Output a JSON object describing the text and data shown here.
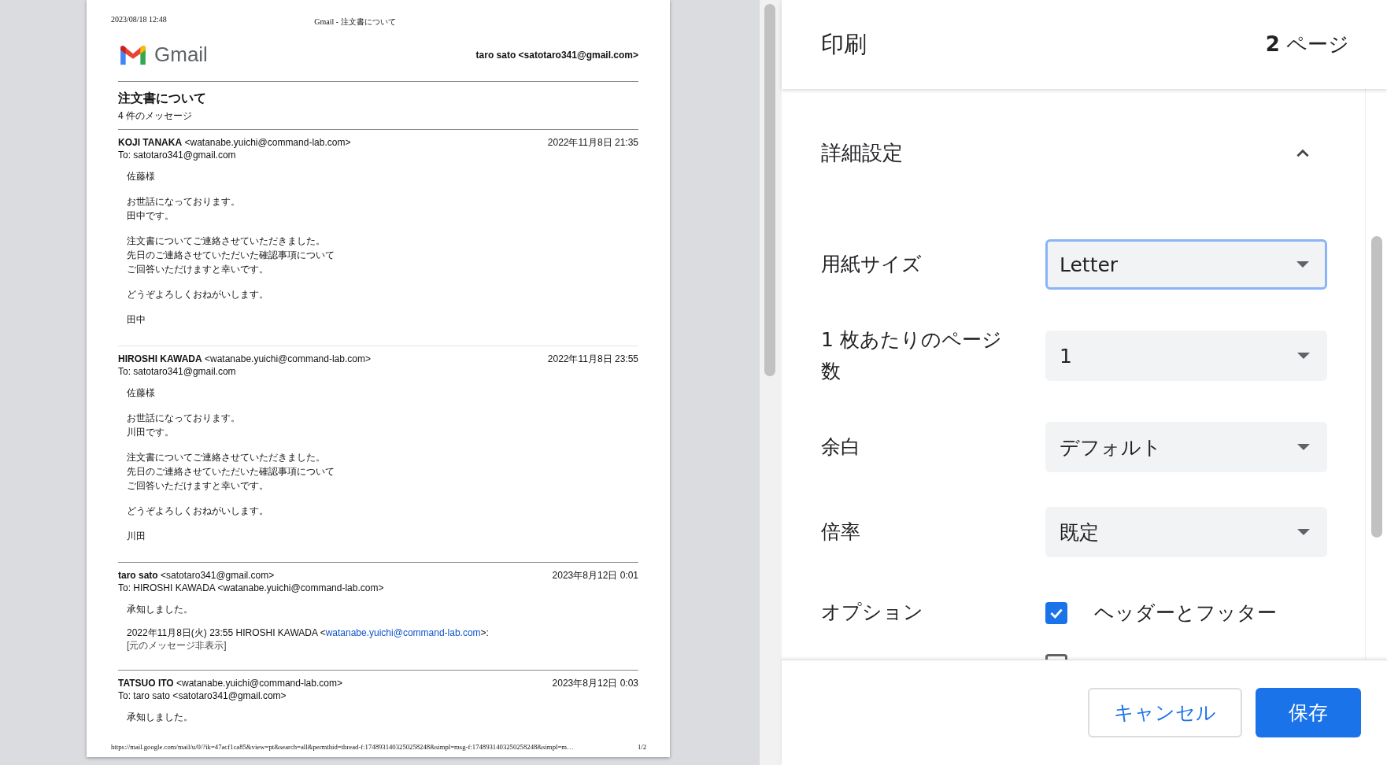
{
  "preview": {
    "header_date": "2023/08/18 12:48",
    "header_title": "Gmail - 注文書について",
    "brand": "Gmail",
    "account": "taro sato <satotaro341@gmail.com>",
    "subject": "注文書について",
    "message_count": "4 件のメッセージ",
    "messages": [
      {
        "sender_name": "KOJI TANAKA",
        "sender_email": "<watanabe.yuichi@command-lab.com>",
        "date": "2022年11月8日 21:35",
        "to": "To: satotaro341@gmail.com",
        "body": [
          [
            "佐藤様"
          ],
          [
            "お世話になっております。",
            "田中です。"
          ],
          [
            "注文書についてご連絡させていただきました。",
            "先日のご連絡させていただいた確認事項について",
            "ご回答いただけますと幸いです。"
          ],
          [
            "どうぞよろしくおねがいします。"
          ],
          [
            "田中"
          ]
        ]
      },
      {
        "sender_name": "HIROSHI KAWADA",
        "sender_email": "<watanabe.yuichi@command-lab.com>",
        "date": "2022年11月8日 23:55",
        "to": "To: satotaro341@gmail.com",
        "body": [
          [
            "佐藤様"
          ],
          [
            "お世話になっております。",
            "川田です。"
          ],
          [
            "注文書についてご連絡させていただきました。",
            "先日のご連絡させていただいた確認事項について",
            "ご回答いただけますと幸いです。"
          ],
          [
            "どうぞよろしくおねがいします。"
          ],
          [
            "川田"
          ]
        ]
      },
      {
        "sender_name": "taro sato",
        "sender_email": "<satotaro341@gmail.com>",
        "date": "2023年8月12日 0:01",
        "to": "To: HIROSHI KAWADA <watanabe.yuichi@command-lab.com>",
        "body": [
          [
            "承知しました。"
          ]
        ],
        "quote": {
          "before": "2022年11月8日(火) 23:55 HIROSHI KAWADA <",
          "link": "watanabe.yuichi@command-lab.com",
          "after": ">:"
        },
        "hidden_note": "[元のメッセージ非表示]"
      },
      {
        "sender_name": "TATSUO ITO",
        "sender_email": "<watanabe.yuichi@command-lab.com>",
        "date": "2023年8月12日 0:03",
        "to": "To: taro sato <satotaro341@gmail.com>",
        "body": [
          [
            "承知しました。"
          ]
        ]
      }
    ],
    "footer_url": "https://mail.google.com/mail/u/0/?ik=47acf1ca85&view=pt&search=all&permthid=thread-f:1748931403250258248&simpl=msg-f:1748931403250258248&simpl=m…",
    "footer_page": "1/2"
  },
  "print_panel": {
    "title": "印刷",
    "page_count": "**2** ページ",
    "advanced": {
      "label": "詳細設定",
      "expanded": true
    },
    "settings": [
      {
        "label": "用紙サイズ",
        "value": "Letter",
        "focused": true
      },
      {
        "label": "1 枚あたりのページ数",
        "value": "1",
        "focused": false
      },
      {
        "label": "余白",
        "value": "デフォルト",
        "focused": false
      },
      {
        "label": "倍率",
        "value": "既定",
        "focused": false
      }
    ],
    "options_label": "オプション",
    "options": [
      {
        "label": "ヘッダーとフッター",
        "checked": true
      },
      {
        "checked": false
      }
    ],
    "buttons": [
      {
        "label": "キャンセル",
        "kind": "secondary"
      },
      {
        "label": "保存",
        "kind": "primary"
      }
    ]
  }
}
